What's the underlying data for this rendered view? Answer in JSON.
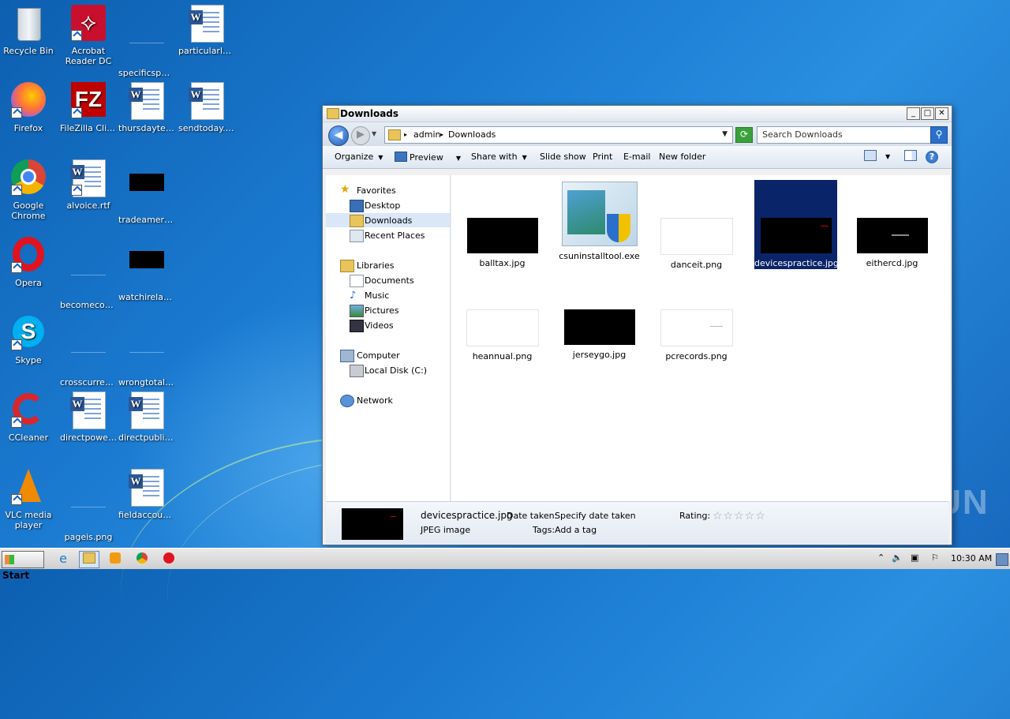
{
  "desktop": {
    "icons": [
      {
        "label": "Recycle Bin",
        "icon": "recycle-bin-icon"
      },
      {
        "label": "Acrobat Reader DC",
        "icon": "acrobat-icon"
      },
      {
        "label": "specificspec...",
        "icon": "blank-file-icon"
      },
      {
        "label": "particularlyd...",
        "icon": "word-doc-icon"
      },
      {
        "label": "Firefox",
        "icon": "firefox-icon"
      },
      {
        "label": "FileZilla Client",
        "icon": "filezilla-icon"
      },
      {
        "label": "thursdaytec...",
        "icon": "word-doc-icon"
      },
      {
        "label": "sendtoday.rtf",
        "icon": "word-doc-icon"
      },
      {
        "label": "Google Chrome",
        "icon": "chrome-icon"
      },
      {
        "label": "alvoice.rtf",
        "icon": "word-doc-icon"
      },
      {
        "label": "tradeameric...",
        "icon": "black-image-icon"
      },
      {
        "label": "Opera",
        "icon": "opera-icon"
      },
      {
        "label": "becomecom...",
        "icon": "blank-file-icon"
      },
      {
        "label": "watchirelan...",
        "icon": "black-image-icon"
      },
      {
        "label": "Skype",
        "icon": "skype-icon"
      },
      {
        "label": "crosscurren...",
        "icon": "blank-file-icon"
      },
      {
        "label": "wrongtotal....",
        "icon": "blank-file-icon"
      },
      {
        "label": "CCleaner",
        "icon": "ccleaner-icon"
      },
      {
        "label": "directpower...",
        "icon": "word-doc-icon"
      },
      {
        "label": "directpublis...",
        "icon": "word-doc-icon"
      },
      {
        "label": "VLC media player",
        "icon": "vlc-icon"
      },
      {
        "label": "pageis.png",
        "icon": "blank-file-icon"
      },
      {
        "label": "fieldaccoun...",
        "icon": "word-doc-icon"
      }
    ]
  },
  "window": {
    "title": "Downloads",
    "controls": {
      "minimize": "_",
      "maximize": "□",
      "close": "✕"
    },
    "address": {
      "crumbs": [
        "admin",
        "Downloads"
      ]
    },
    "search_placeholder": "Search Downloads",
    "toolbar": {
      "organize": "Organize",
      "preview": "Preview",
      "share_with": "Share with",
      "slide_show": "Slide show",
      "print": "Print",
      "email": "E-mail",
      "new_folder": "New folder"
    },
    "nav": {
      "favorites": "Favorites",
      "desktop": "Desktop",
      "downloads": "Downloads",
      "recent_places": "Recent Places",
      "libraries": "Libraries",
      "documents": "Documents",
      "music": "Music",
      "pictures": "Pictures",
      "videos": "Videos",
      "computer": "Computer",
      "local_disk": "Local Disk (C:)",
      "network": "Network"
    },
    "files": [
      {
        "name": "balltax.jpg",
        "thumb": "black"
      },
      {
        "name": "csuninstalltool.exe",
        "thumb": "installer"
      },
      {
        "name": "danceit.png",
        "thumb": "white"
      },
      {
        "name": "devicespractice.jpg",
        "thumb": "black",
        "selected": true
      },
      {
        "name": "eithercd.jpg",
        "thumb": "black"
      },
      {
        "name": "heannual.png",
        "thumb": "white"
      },
      {
        "name": "jerseygo.jpg",
        "thumb": "black"
      },
      {
        "name": "pcrecords.png",
        "thumb": "white"
      }
    ],
    "details": {
      "filename": "devicespractice.jpg",
      "filetype": "JPEG image",
      "date_label": "Date taken:",
      "date_value": "Specify date taken",
      "tags_label": "Tags:",
      "tags_value": "Add a tag",
      "rating_label": "Rating:",
      "rating_stars": "☆☆☆☆☆"
    }
  },
  "taskbar": {
    "start": "Start",
    "clock": "10:30 AM"
  },
  "watermark": "ANY RUN"
}
